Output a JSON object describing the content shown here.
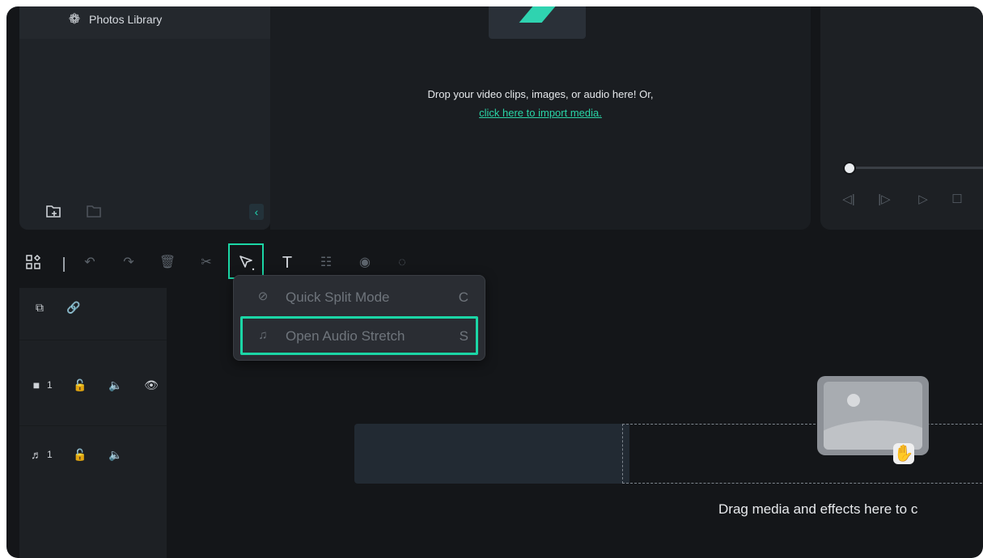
{
  "media": {
    "library_label": "Photos Library",
    "collapse_glyph": "‹"
  },
  "drop_zone": {
    "text": "Drop your video clips, images, or audio here! Or,",
    "link": "click here to import media."
  },
  "toolbar": {
    "icons": [
      "layout-icon",
      "undo-icon",
      "redo-icon",
      "delete-icon",
      "cut-icon",
      "select-tool-icon",
      "text-icon",
      "adjust-icon",
      "audio-icon",
      "speed-icon"
    ],
    "text_glyph": "T"
  },
  "menu": {
    "items": [
      {
        "label": "Quick Split Mode",
        "shortcut": "C"
      },
      {
        "label": "Open Audio Stretch",
        "shortcut": "S"
      }
    ]
  },
  "tracks": [
    {
      "type": "video",
      "number": "1"
    },
    {
      "type": "audio",
      "number": "1"
    }
  ],
  "timeline": {
    "drag_hint": "Drag media and effects here to c"
  },
  "colors": {
    "accent": "#1bd6a6",
    "background": "#141619",
    "panel": "#1f2328"
  }
}
